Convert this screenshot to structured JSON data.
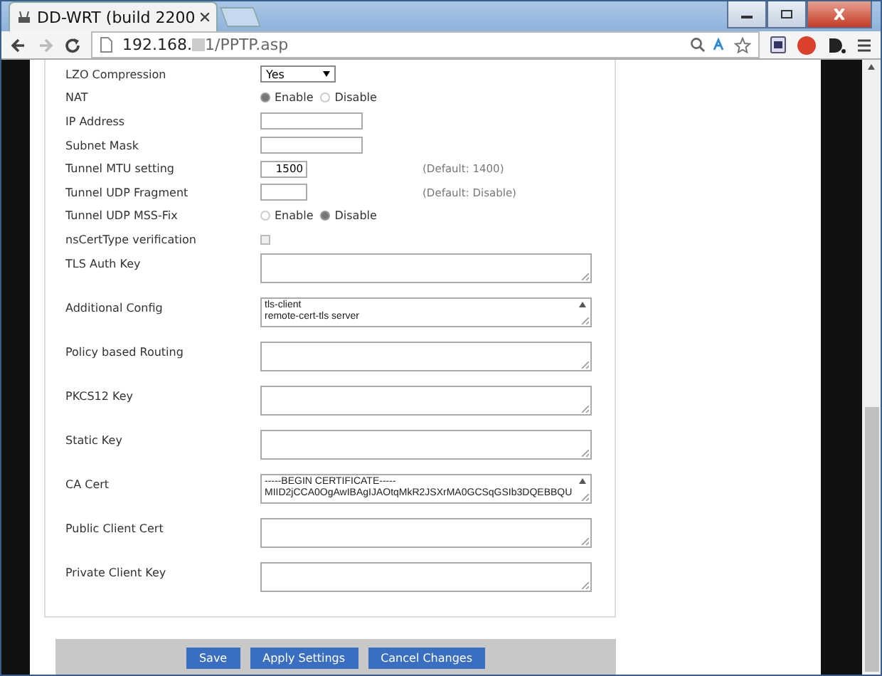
{
  "browser": {
    "tab_title": "DD-WRT (build 2200",
    "url_start": "192.168.",
    "url_end": "1/PPTP.asp"
  },
  "fields": [
    {
      "kind": "select",
      "label": "LZO Compression",
      "value": "Yes"
    },
    {
      "kind": "radio",
      "label": "NAT",
      "options": [
        {
          "label": "Enable",
          "selected": true
        },
        {
          "label": "Disable",
          "selected": false
        }
      ]
    },
    {
      "kind": "text",
      "label": "IP Address"
    },
    {
      "kind": "text",
      "label": "Subnet Mask"
    },
    {
      "kind": "short_text",
      "label": "Tunnel MTU setting",
      "value": "1500",
      "hint": "(Default: 1400)"
    },
    {
      "kind": "short_text",
      "label": "Tunnel UDP Fragment",
      "hint": "(Default: Disable)"
    },
    {
      "kind": "radio",
      "label": "Tunnel UDP MSS-Fix",
      "options": [
        {
          "label": "Enable",
          "selected": false
        },
        {
          "label": "Disable",
          "selected": true
        }
      ]
    },
    {
      "kind": "checkbox",
      "label": "nsCertType verification",
      "checked": false
    },
    {
      "kind": "textarea",
      "label": "TLS Auth Key"
    },
    {
      "kind": "textarea",
      "label": "Additional Config",
      "lines": [
        "tls-client",
        "remote-cert-tls server"
      ]
    },
    {
      "kind": "textarea",
      "label": "Policy based Routing"
    },
    {
      "kind": "textarea",
      "label": "PKCS12 Key"
    },
    {
      "kind": "textarea",
      "label": "Static Key"
    },
    {
      "kind": "textarea",
      "label": "CA Cert",
      "lines": [
        "-----BEGIN CERTIFICATE-----",
        "MIID2jCCA0OgAwIBAgIJAOtqMkR2JSXrMA0GCSqGSIb3DQEBBQU"
      ]
    },
    {
      "kind": "textarea",
      "label": "Public Client Cert"
    },
    {
      "kind": "textarea",
      "label": "Private Client Key"
    }
  ],
  "buttons": [
    "Save",
    "Apply Settings",
    "Cancel Changes"
  ]
}
